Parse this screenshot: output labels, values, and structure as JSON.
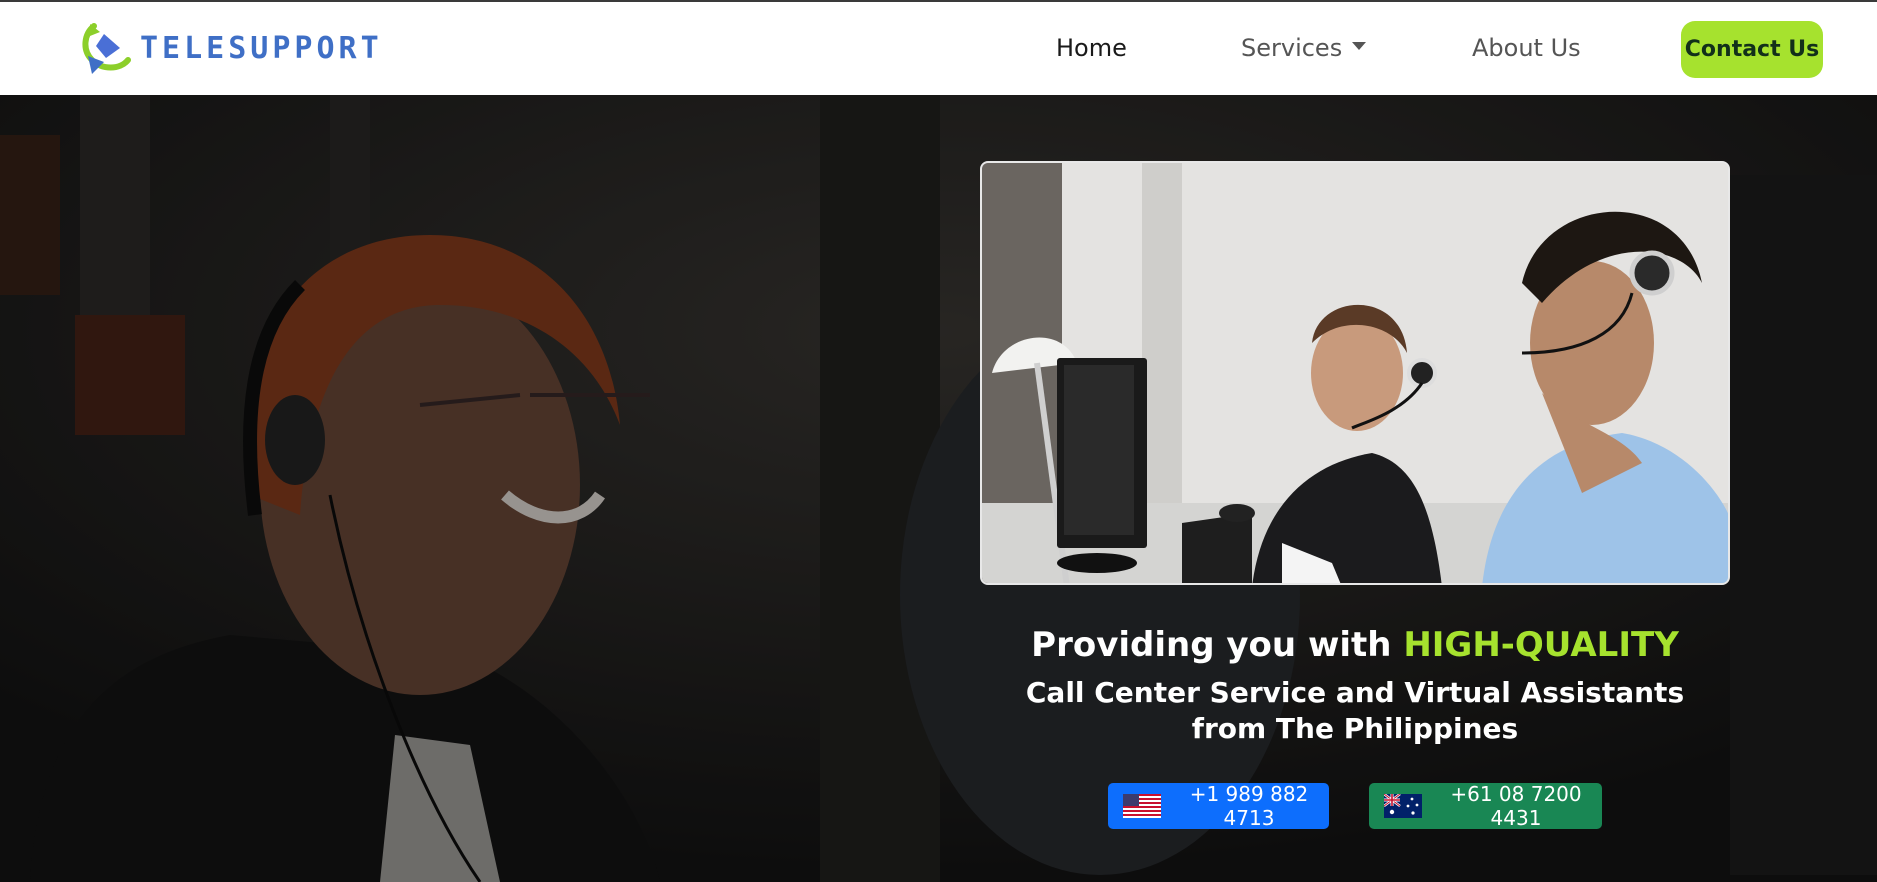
{
  "navbar": {
    "brand_name": "TELESUPPORT",
    "logo_icon": "telesupport-logo-icon",
    "links": {
      "home": "Home",
      "services": "Services",
      "about": "About Us"
    },
    "contact_label": "Contact Us"
  },
  "hero": {
    "headline_prefix": "Providing you with",
    "headline_accent": "HIGH-QUALITY",
    "subheadline": "Call Center Service and Virtual Assistants from The Philippines",
    "phones": {
      "us": {
        "number": "+1 989 882 4713",
        "flag_icon": "us-flag-icon"
      },
      "au": {
        "number": "+61 08 7200 4431",
        "flag_icon": "au-flag-icon"
      }
    }
  },
  "colors": {
    "brand_blue": "#3f6fc6",
    "accent_green": "#a6e22e",
    "us_button": "#0d6efd",
    "au_button": "#198754"
  }
}
